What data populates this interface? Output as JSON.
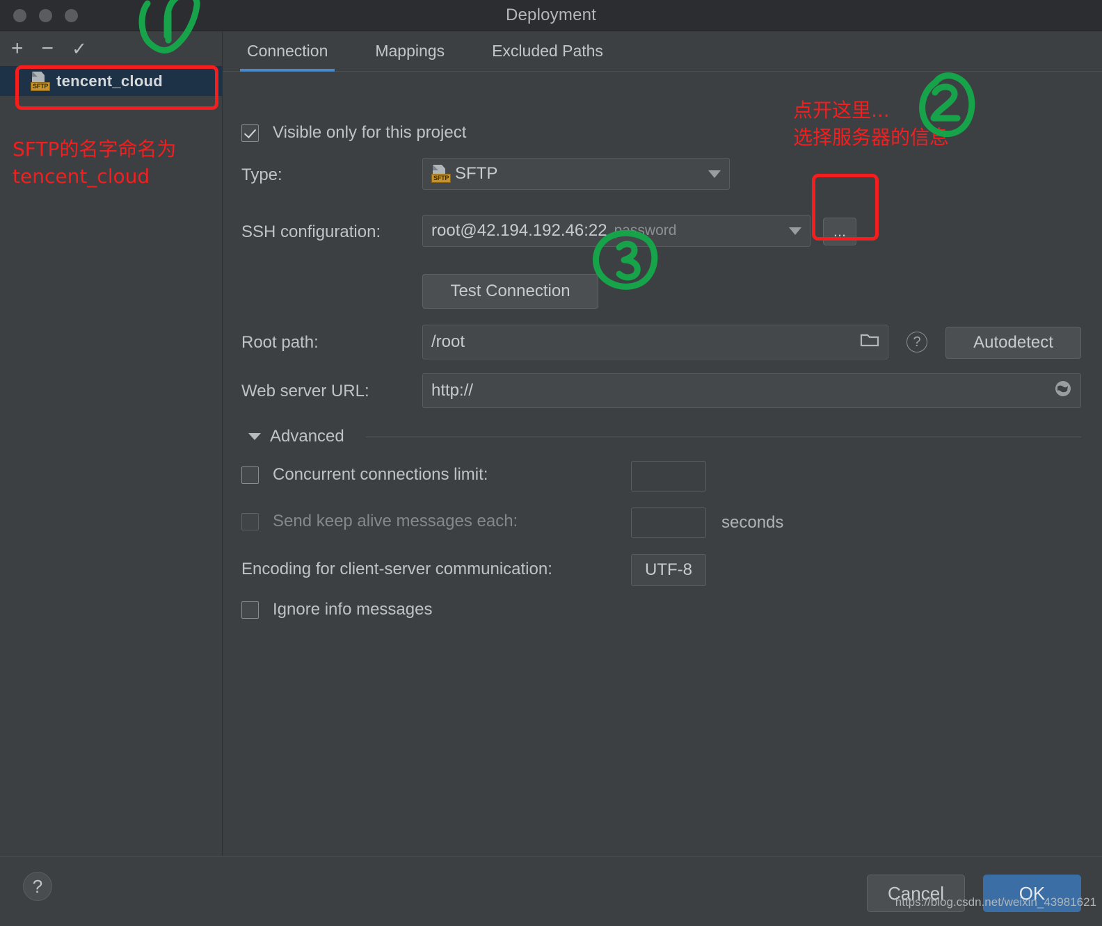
{
  "window": {
    "title": "Deployment",
    "traffic_lights": [
      "close-button",
      "minimize-button",
      "zoom-button"
    ]
  },
  "sidebar": {
    "toolbar": {
      "add_label": "+",
      "remove_label": "−",
      "apply_label": "✓"
    },
    "items": [
      {
        "label": "tencent_cloud",
        "icon": "sftp-badge",
        "badge": "SFTP",
        "selected": true
      }
    ]
  },
  "tabs": [
    {
      "label": "Connection",
      "active": true
    },
    {
      "label": "Mappings",
      "active": false
    },
    {
      "label": "Excluded Paths",
      "active": false
    }
  ],
  "form": {
    "visible_only": {
      "label": "Visible only for this project",
      "checked": true
    },
    "type": {
      "label": "Type:",
      "value": "SFTP",
      "badge": "SFTP"
    },
    "ssh_configuration": {
      "label": "SSH configuration:",
      "value": "root@42.194.192.46:22",
      "auth_hint": "password",
      "browse_label": "..."
    },
    "test_connection": {
      "label": "Test Connection"
    },
    "root_path": {
      "label": "Root path:",
      "value": "/root",
      "autodetect_label": "Autodetect",
      "help_label": "?"
    },
    "web_server_url": {
      "label": "Web server URL:",
      "value": "http://"
    },
    "advanced": {
      "label": "Advanced",
      "concurrent": {
        "label": "Concurrent connections limit:",
        "value": "",
        "checked": false
      },
      "keep_alive": {
        "label": "Send keep alive messages each:",
        "value": "",
        "unit": "seconds",
        "checked": false,
        "disabled": true
      },
      "encoding": {
        "label": "Encoding for client-server communication:",
        "value": "UTF-8"
      },
      "ignore_info": {
        "label": "Ignore info messages",
        "checked": false
      }
    }
  },
  "footer": {
    "help_label": "?",
    "cancel_label": "Cancel",
    "ok_label": "OK",
    "watermark": "https://blog.csdn.net/weixin_43981621"
  },
  "annotations": {
    "sidebar_note": "SFTP的名字命名为\ntencent_cloud",
    "ssh_note": "点开这里...\n选择服务器的信息",
    "step_1": "1",
    "step_2": "2",
    "step_3": "3",
    "red": "#f41e1e",
    "green": "#16a34a"
  }
}
